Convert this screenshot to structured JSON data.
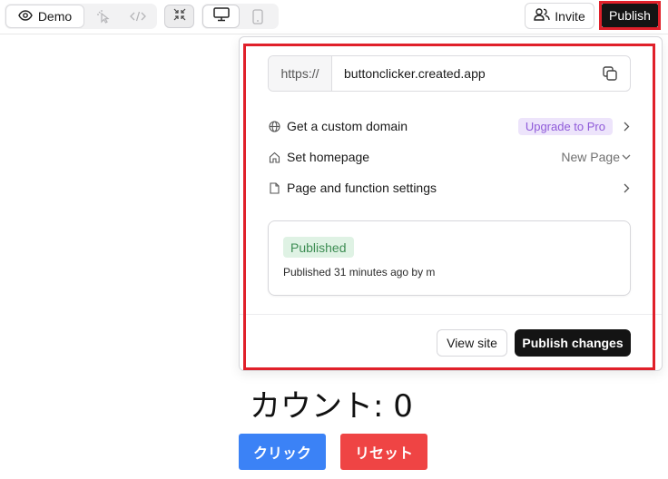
{
  "toolbar": {
    "demo_label": "Demo",
    "invite_label": "Invite",
    "publish_label": "Publish",
    "icons": [
      "eye-icon",
      "cursor-click-icon",
      "code-icon",
      "collapse-icon",
      "desktop-icon",
      "mobile-icon",
      "users-icon"
    ]
  },
  "popover": {
    "url_prefix": "https://",
    "url_value": "buttonclicker.created.app",
    "rows": {
      "custom_domain": {
        "label": "Get a custom domain",
        "badge": "Upgrade to Pro"
      },
      "homepage": {
        "label": "Set homepage",
        "value": "New Page"
      },
      "settings": {
        "label": "Page and function settings"
      }
    },
    "status": {
      "badge": "Published",
      "meta": "Published 31 minutes ago by m"
    },
    "view_site_label": "View site",
    "publish_changes_label": "Publish changes"
  },
  "page": {
    "counter": "カウント: 0",
    "click_label": "クリック",
    "reset_label": "リセット"
  },
  "colors": {
    "highlight": "#e0202a",
    "primary_dark": "#141414",
    "pro_badge_bg": "#ede4fb",
    "pro_badge_text": "#8f5ad9",
    "published_bg": "#dff2e4",
    "published_text": "#3d8d53",
    "click_button": "#3b82f6",
    "reset_button": "#ef4444"
  }
}
